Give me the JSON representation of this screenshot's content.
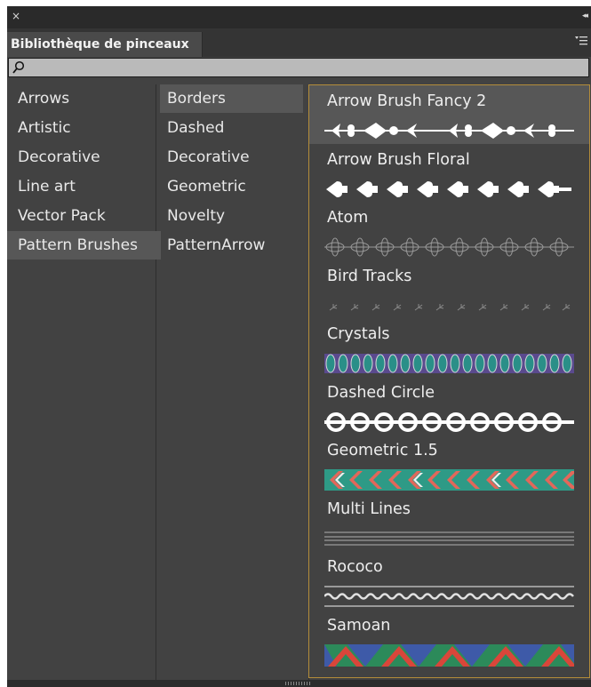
{
  "window": {
    "close_glyph": "×",
    "collapse_glyph": "◂◂"
  },
  "tab": {
    "title": "Bibliothèque de pinceaux"
  },
  "search": {
    "value": "",
    "placeholder": ""
  },
  "categories": [
    {
      "label": "Arrows",
      "selected": false
    },
    {
      "label": "Artistic",
      "selected": false
    },
    {
      "label": "Decorative",
      "selected": false
    },
    {
      "label": "Line art",
      "selected": false
    },
    {
      "label": "Vector Pack",
      "selected": false
    },
    {
      "label": "Pattern Brushes",
      "selected": true
    }
  ],
  "subcategories": [
    {
      "label": "Borders",
      "selected": true
    },
    {
      "label": "Dashed",
      "selected": false
    },
    {
      "label": "Decorative",
      "selected": false
    },
    {
      "label": "Geometric",
      "selected": false
    },
    {
      "label": "Novelty",
      "selected": false
    },
    {
      "label": "PatternArrow",
      "selected": false
    }
  ],
  "brushes": [
    {
      "name": "Arrow Brush Fancy 2",
      "selected": true,
      "preview": "arrow-fancy"
    },
    {
      "name": "Arrow Brush Floral",
      "selected": false,
      "preview": "arrow-floral"
    },
    {
      "name": "Atom",
      "selected": false,
      "preview": "atom"
    },
    {
      "name": "Bird Tracks",
      "selected": false,
      "preview": "bird-tracks"
    },
    {
      "name": "Crystals",
      "selected": false,
      "preview": "crystals"
    },
    {
      "name": "Dashed Circle",
      "selected": false,
      "preview": "dashed-circle"
    },
    {
      "name": "Geometric 1.5",
      "selected": false,
      "preview": "geometric"
    },
    {
      "name": "Multi Lines",
      "selected": false,
      "preview": "multi-lines"
    },
    {
      "name": "Rococo",
      "selected": false,
      "preview": "rococo"
    },
    {
      "name": "Samoan",
      "selected": false,
      "preview": "samoan"
    }
  ],
  "colors": {
    "panel_bg": "#424242",
    "selection_bg": "#575757",
    "focus_border": "#b48d3a",
    "text": "#e9e9e9",
    "crystals_teal": "#2a8f88",
    "crystals_purple": "#5a4a8e",
    "geometric_teal": "#2e9a86",
    "geometric_coral": "#e2675a",
    "samoan_red": "#d9463a",
    "samoan_green": "#2c8a5a",
    "samoan_blue": "#3e5aa8"
  }
}
